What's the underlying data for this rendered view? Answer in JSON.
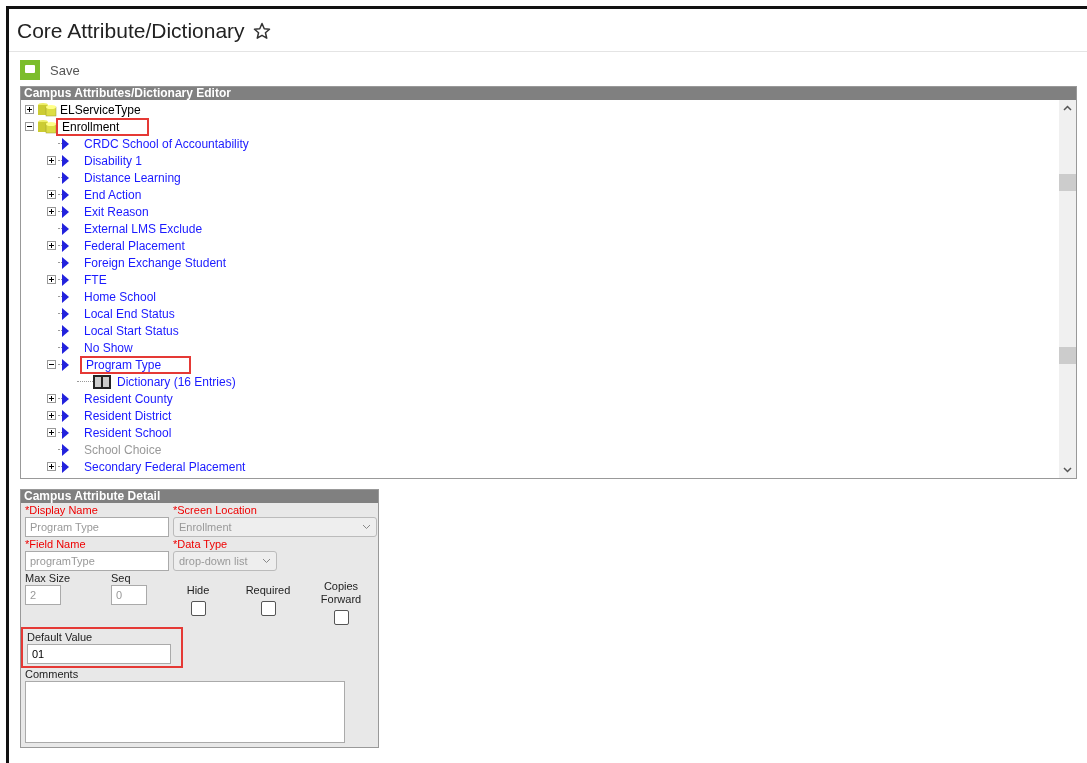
{
  "page": {
    "title": "Core Attribute/Dictionary",
    "starred": false
  },
  "toolbar": {
    "save_label": "Save"
  },
  "tree_panel": {
    "title": "Campus Attributes/Dictionary Editor",
    "nodes": [
      {
        "kind": "folder",
        "label": "ELServiceType",
        "expanded": false,
        "highlighted": false,
        "disabled": false
      },
      {
        "kind": "folder",
        "label": "Enrollment",
        "expanded": true,
        "highlighted": true,
        "disabled": false,
        "children": [
          {
            "kind": "attribute",
            "label": "CRDC School of Accountability",
            "highlighted": false,
            "disabled": false
          },
          {
            "kind": "attribute",
            "label": "Disability 1",
            "expanded": false,
            "highlighted": false,
            "disabled": false
          },
          {
            "kind": "attribute",
            "label": "Distance Learning",
            "highlighted": false,
            "disabled": false
          },
          {
            "kind": "attribute",
            "label": "End Action",
            "expanded": false,
            "highlighted": false,
            "disabled": false
          },
          {
            "kind": "attribute",
            "label": "Exit Reason",
            "expanded": false,
            "highlighted": false,
            "disabled": false
          },
          {
            "kind": "attribute",
            "label": "External LMS Exclude",
            "highlighted": false,
            "disabled": false
          },
          {
            "kind": "attribute",
            "label": "Federal Placement",
            "expanded": false,
            "highlighted": false,
            "disabled": false
          },
          {
            "kind": "attribute",
            "label": "Foreign Exchange Student",
            "highlighted": false,
            "disabled": false
          },
          {
            "kind": "attribute",
            "label": "FTE",
            "expanded": false,
            "highlighted": false,
            "disabled": false
          },
          {
            "kind": "attribute",
            "label": "Home School",
            "highlighted": false,
            "disabled": false
          },
          {
            "kind": "attribute",
            "label": "Local End Status",
            "highlighted": false,
            "disabled": false
          },
          {
            "kind": "attribute",
            "label": "Local Start Status",
            "highlighted": false,
            "disabled": false
          },
          {
            "kind": "attribute",
            "label": "No Show",
            "highlighted": false,
            "disabled": false
          },
          {
            "kind": "attribute",
            "label": "Program Type",
            "expanded": true,
            "highlighted": true,
            "disabled": false,
            "children": [
              {
                "kind": "dictionary",
                "label": "Dictionary (16 Entries)",
                "highlighted": false,
                "disabled": false
              }
            ]
          },
          {
            "kind": "attribute",
            "label": "Resident County",
            "expanded": false,
            "highlighted": false,
            "disabled": false
          },
          {
            "kind": "attribute",
            "label": "Resident District",
            "expanded": false,
            "highlighted": false,
            "disabled": false
          },
          {
            "kind": "attribute",
            "label": "Resident School",
            "expanded": false,
            "highlighted": false,
            "disabled": false
          },
          {
            "kind": "attribute",
            "label": "School Choice",
            "highlighted": false,
            "disabled": true
          },
          {
            "kind": "attribute",
            "label": "Secondary Federal Placement",
            "expanded": false,
            "highlighted": false,
            "disabled": false
          }
        ]
      }
    ]
  },
  "detail_panel": {
    "title": "Campus Attribute Detail",
    "display_name": {
      "label": "*Display Name",
      "value": "Program Type",
      "disabled": true
    },
    "screen_location": {
      "label": "*Screen Location",
      "value": "Enrollment"
    },
    "field_name": {
      "label": "*Field Name",
      "value": "programType",
      "disabled": true
    },
    "data_type": {
      "label": "*Data Type",
      "value": "drop-down list"
    },
    "max_size": {
      "label": "Max Size",
      "value": "2",
      "disabled": true
    },
    "seq": {
      "label": "Seq",
      "value": "0",
      "disabled": true
    },
    "checkboxes": [
      {
        "label": "Hide",
        "checked": false
      },
      {
        "label": "Required",
        "checked": false
      },
      {
        "label": "Copies Forward",
        "checked": false
      }
    ],
    "default_value": {
      "label": "Default Value",
      "value": "01",
      "highlighted": true,
      "disabled": false
    },
    "comments": {
      "label": "Comments"
    }
  }
}
